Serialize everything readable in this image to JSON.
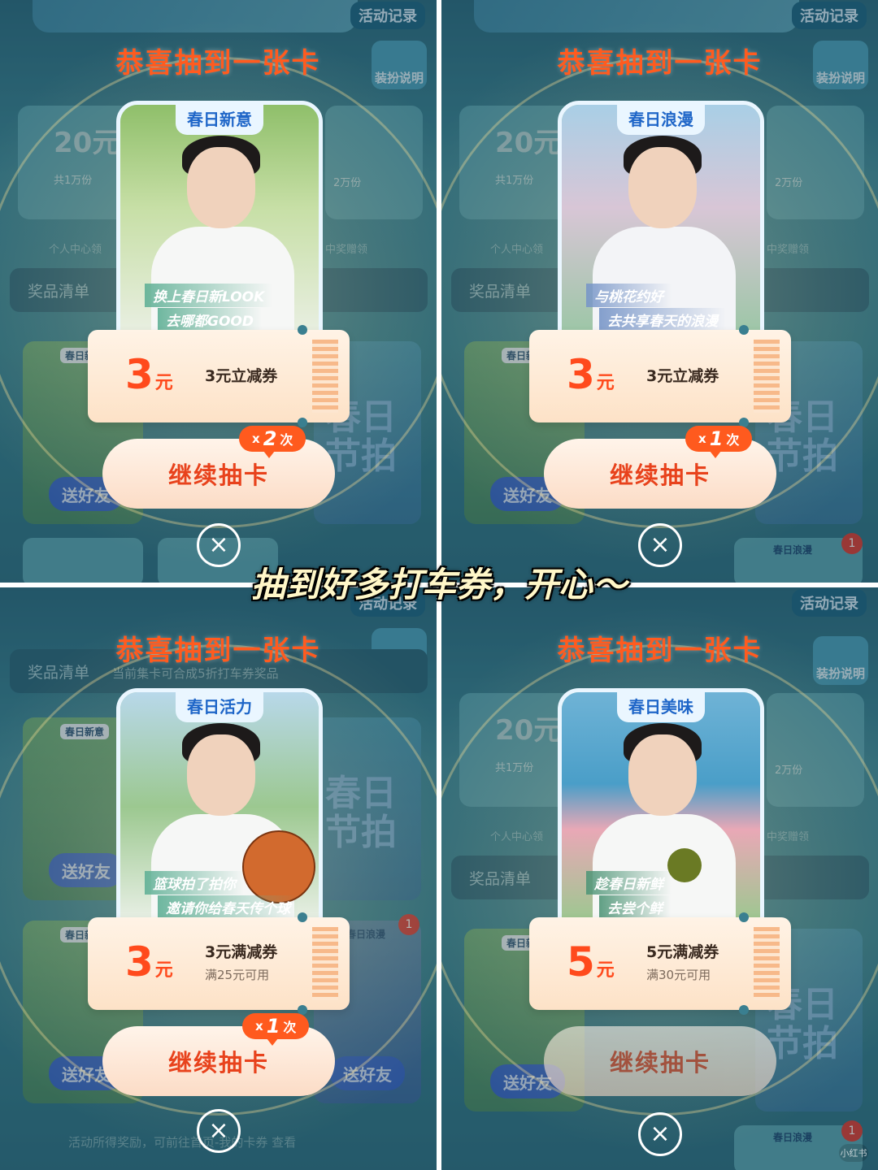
{
  "background": {
    "record_label": "活动记录",
    "rules_label": "装扮说明",
    "coupon_amount": "20元",
    "coupon_count": "共1万份",
    "vip_count": "2万份",
    "center_text": "个人中心领",
    "center_text2": "中奖赠领",
    "prize_list_label": "奖品清单",
    "prize_list_sub": "当前集卡可合成5折打车券奖品",
    "send_label": "送好友",
    "chip_new": "春日新意",
    "chip_romance": "春日浪漫",
    "big_text": "春日节拍",
    "red_dot": "1",
    "footer_note": "活动所得奖励，可前往首页-我的卡券 查看"
  },
  "panels": [
    {
      "title": "恭喜抽到一张卡",
      "card_label": "春日新意",
      "slogan1": "换上春日新LOOK",
      "slogan2": "去哪都GOOD",
      "coupon_amount": "3",
      "coupon_unit": "元",
      "coupon_name": "3元立减券",
      "coupon_condition": "",
      "continue_label": "继续抽卡",
      "badge_prefix": "x",
      "badge_count": "2",
      "badge_suffix": "次",
      "close_icon": "×"
    },
    {
      "title": "恭喜抽到一张卡",
      "card_label": "春日浪漫",
      "slogan1": "与桃花约好",
      "slogan2": "去共享春天的浪漫",
      "coupon_amount": "3",
      "coupon_unit": "元",
      "coupon_name": "3元立减券",
      "coupon_condition": "",
      "continue_label": "继续抽卡",
      "badge_prefix": "x",
      "badge_count": "1",
      "badge_suffix": "次",
      "close_icon": "×"
    },
    {
      "title": "恭喜抽到一张卡",
      "card_label": "春日活力",
      "slogan1": "篮球拍了拍你",
      "slogan2": "邀请你给春天传个球",
      "coupon_amount": "3",
      "coupon_unit": "元",
      "coupon_name": "3元满减券",
      "coupon_condition": "满25元可用",
      "continue_label": "继续抽卡",
      "badge_prefix": "x",
      "badge_count": "1",
      "badge_suffix": "次",
      "close_icon": "×"
    },
    {
      "title": "恭喜抽到一张卡",
      "card_label": "春日美味",
      "slogan1": "趁春日新鲜",
      "slogan2": "去尝个鲜",
      "coupon_amount": "5",
      "coupon_unit": "元",
      "coupon_name": "5元满减券",
      "coupon_condition": "满30元可用",
      "continue_label": "继续抽卡",
      "close_icon": "×"
    }
  ],
  "caption": "抽到好多打车券，开心～",
  "watermark": "小红书",
  "colors": {
    "title_orange": "#ff5b1f",
    "badge_orange": "#ff5a1e",
    "card_label_blue": "#1f66c8",
    "card_bg": [
      "#8fc6a0",
      "#b9d6e6",
      "#a9d2a0",
      "#7fb9d6"
    ]
  }
}
